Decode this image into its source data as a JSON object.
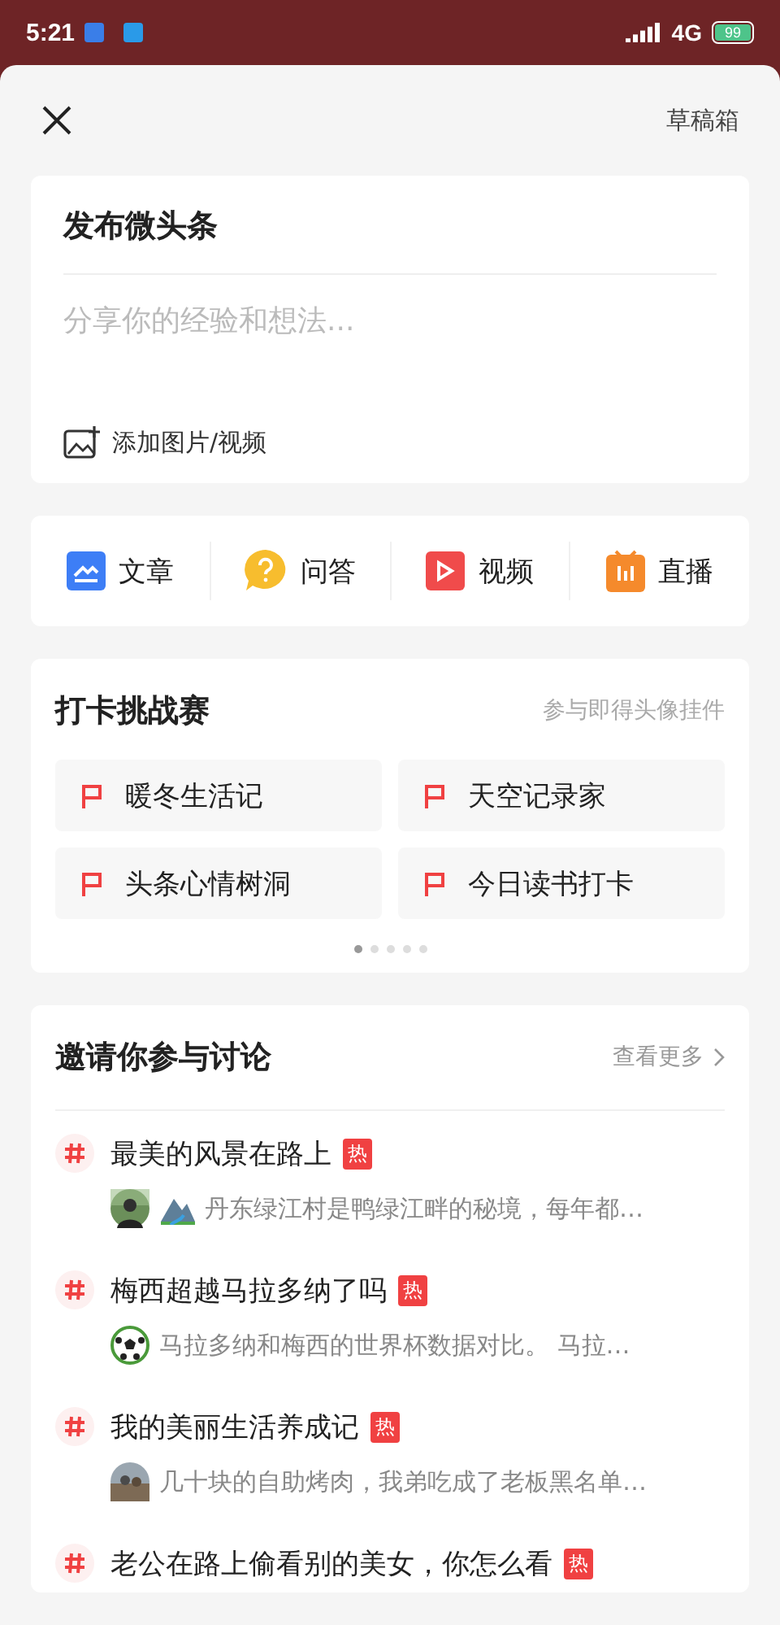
{
  "status_bar": {
    "time": "5:21",
    "network": "4G",
    "battery": "99"
  },
  "header": {
    "drafts": "草稿箱"
  },
  "composer": {
    "title": "发布微头条",
    "placeholder": "分享你的经验和想法...",
    "media": "添加图片/视频"
  },
  "post_types": [
    {
      "kind": "article",
      "label": "文章"
    },
    {
      "kind": "qa",
      "label": "问答"
    },
    {
      "kind": "video",
      "label": "视频"
    },
    {
      "kind": "live",
      "label": "直播"
    }
  ],
  "challenges": {
    "title": "打卡挑战赛",
    "hint": "参与即得头像挂件",
    "items": [
      "暖冬生活记",
      "天空记录家",
      "头条心情树洞",
      "今日读书打卡"
    ],
    "pages": [
      {
        "selected": true
      },
      {
        "selected": false
      },
      {
        "selected": false
      },
      {
        "selected": false
      },
      {
        "selected": false
      }
    ]
  },
  "discussions": {
    "title": "邀请你参与讨论",
    "more": "查看更多",
    "items": [
      {
        "topic": "最美的风景在路上",
        "badge": "热",
        "summary": {
          "kind": "person",
          "scenery": true,
          "text": "丹东绿江村是鸭绿江畔的秘境，每年都…"
        }
      },
      {
        "topic": "梅西超越马拉多纳了吗",
        "badge": "热",
        "summary": {
          "kind": "ball",
          "scenery": false,
          "text": "马拉多纳和梅西的世界杯数据对比。 马拉…"
        }
      },
      {
        "topic": "我的美丽生活养成记",
        "badge": "热",
        "summary": {
          "kind": "crowd",
          "scenery": false,
          "text": "几十块的自助烤肉，我弟吃成了老板黑名单…"
        }
      },
      {
        "topic": "老公在路上偷看别的美女，你怎么看",
        "badge": "热"
      }
    ]
  }
}
